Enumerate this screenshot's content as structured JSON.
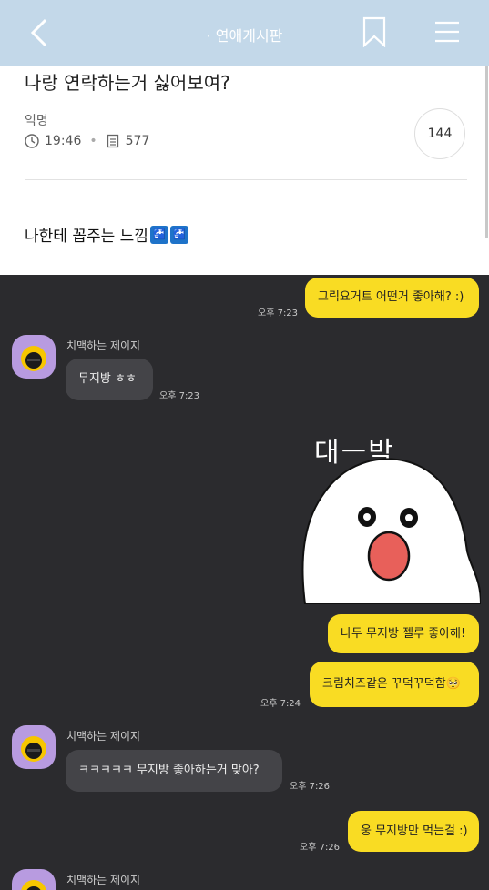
{
  "header": {
    "title": "· 연애게시판"
  },
  "post": {
    "title": "나랑 연락하는거 싫어보여?",
    "author": "익명",
    "time": "19:46",
    "views": "577",
    "comments": "144",
    "body": "나한테 꼽주는 느낌"
  },
  "chat": {
    "messages": [
      {
        "text": "그릭요거트 어떤거 좋아해? :)",
        "time": "오후 7:23"
      },
      {
        "sender": "치맥하는 제이지",
        "text": "무지방 ㅎㅎ",
        "time": "오후 7:23"
      },
      {
        "sticker_text": "대ㅡ박"
      },
      {
        "text": "나두 무지방 젤루 좋아해!"
      },
      {
        "text": "크림치즈같은 꾸덕꾸덕함🥺",
        "time": "오후 7:24"
      },
      {
        "sender": "치맥하는 제이지",
        "text": "ㅋㅋㅋㅋㅋ 무지방 좋아하는거 맞아?",
        "time": "오후 7:26"
      },
      {
        "text": "웅 무지방만 먹는걸 :)",
        "time": "오후 7:26"
      },
      {
        "sender": "치맥하는 제이지"
      }
    ]
  },
  "colors": {
    "header": "#c3d8e9",
    "my_bubble": "#f9dc23",
    "chat_bg": "#2b2b2e"
  }
}
